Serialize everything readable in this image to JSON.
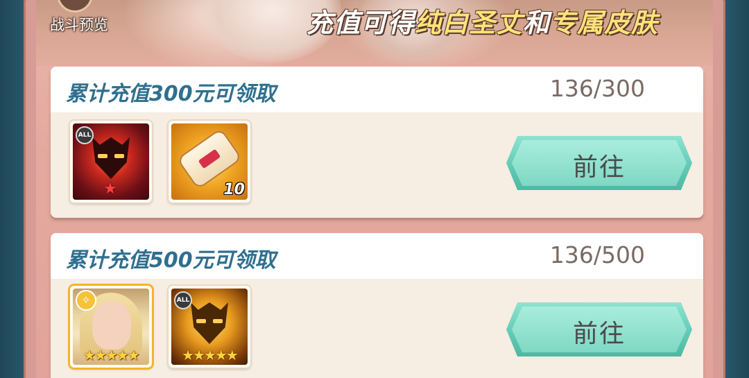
{
  "banner": {
    "preview_label": "战斗预览",
    "headline_part1": "充值可得",
    "headline_part2": "纯白圣丈",
    "headline_part3": "和",
    "headline_part4": "专属皮肤"
  },
  "tiers": [
    {
      "title": "累计充值300元可领取",
      "progress": "136/300",
      "button_label": "前往",
      "rewards": [
        {
          "icon": "crimson-mask-icon",
          "badge": "ALL"
        },
        {
          "icon": "scroll-icon",
          "count": "10"
        }
      ]
    },
    {
      "title": "累计充值500元可领取",
      "progress": "136/500",
      "button_label": "前往",
      "rewards": [
        {
          "icon": "hero-portrait-icon",
          "stars": "★★★★★"
        },
        {
          "icon": "golden-mask-icon",
          "badge": "ALL",
          "stars": "★★★★★"
        }
      ]
    }
  ],
  "colors": {
    "title": "#2f6f8f",
    "button": "#7fd8c4",
    "headline_highlight": "#ffe27a"
  }
}
